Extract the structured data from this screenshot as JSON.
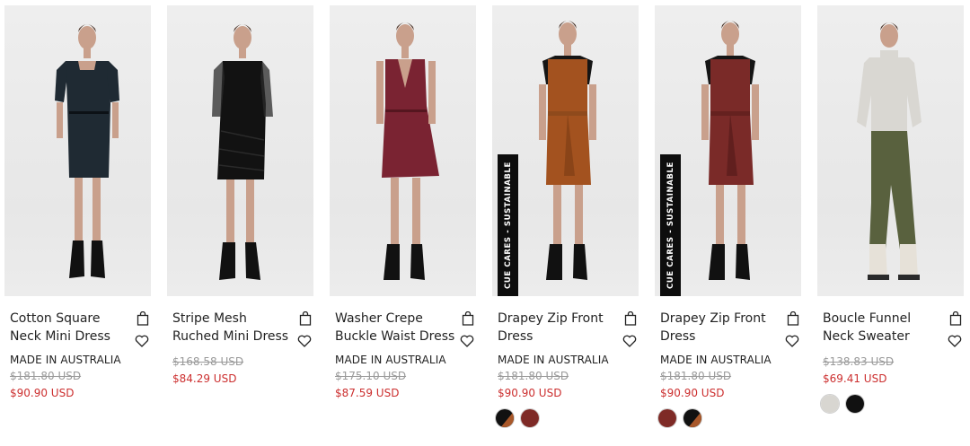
{
  "products": [
    {
      "name": "Cotton Square Neck Mini Dress",
      "title_lines": [
        "Cotton Square",
        "Neck Mini Dress"
      ],
      "origin": "MADE IN AUSTRALIA",
      "was_price": "$181.80 USD",
      "price": "$90.90 USD",
      "badge": "",
      "swatches": []
    },
    {
      "name": "Stripe Mesh Ruched Mini Dress",
      "title_lines": [
        "Stripe Mesh",
        "Ruched Mini Dress"
      ],
      "origin": "",
      "was_price": "$168.58 USD",
      "price": "$84.29 USD",
      "badge": "",
      "swatches": []
    },
    {
      "name": "Washer Crepe Buckle Waist Dress",
      "title_lines": [
        "Washer Crepe",
        "Buckle Waist Dress"
      ],
      "origin": "MADE IN AUSTRALIA",
      "was_price": "$175.10 USD",
      "price": "$87.59 USD",
      "badge": "",
      "swatches": []
    },
    {
      "name": "Drapey Zip Front Dress",
      "title_lines": [
        "Drapey Zip Front",
        "Dress"
      ],
      "origin": "MADE IN AUSTRALIA",
      "was_price": "$181.80 USD",
      "price": "$90.90 USD",
      "badge": "CUE CARES - SUSTAINABLE",
      "swatches": [
        {
          "name": "black-rust",
          "colors": [
            "#111111",
            "#a9582a"
          ]
        },
        {
          "name": "burgundy",
          "colors": [
            "#7e2a26",
            "#7e2a26"
          ]
        }
      ]
    },
    {
      "name": "Drapey Zip Front Dress",
      "title_lines": [
        "Drapey Zip Front",
        "Dress"
      ],
      "origin": "MADE IN AUSTRALIA",
      "was_price": "$181.80 USD",
      "price": "$90.90 USD",
      "badge": "CUE CARES - SUSTAINABLE",
      "swatches": [
        {
          "name": "burgundy",
          "colors": [
            "#7e2a26",
            "#7e2a26"
          ]
        },
        {
          "name": "black-rust",
          "colors": [
            "#111111",
            "#a9582a"
          ]
        }
      ]
    },
    {
      "name": "Boucle Funnel Neck Sweater",
      "title_lines": [
        "Boucle Funnel",
        "Neck Sweater"
      ],
      "origin": "",
      "was_price": "$138.83 USD",
      "price": "$69.41 USD",
      "badge": "",
      "swatches": [
        {
          "name": "oatmeal",
          "colors": [
            "#d8d6d1",
            "#d8d6d1"
          ]
        },
        {
          "name": "black",
          "colors": [
            "#111111",
            "#111111"
          ]
        }
      ]
    }
  ],
  "colors": {
    "sale_price": "#cc2f2f",
    "was_price": "#9a9a9a",
    "text": "#222222",
    "photo_bg": "#ececec",
    "badge_bg": "#0d0d0d"
  },
  "icons": {
    "bag": "shopping-bag-icon",
    "wishlist": "heart-icon"
  }
}
